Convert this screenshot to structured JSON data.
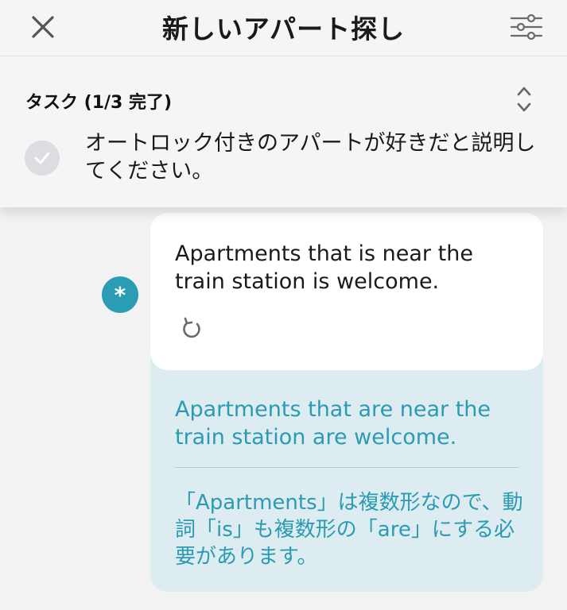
{
  "header": {
    "title": "新しいアパート探し",
    "close_icon": "close-icon",
    "filter_icon": "sliders-icon"
  },
  "task": {
    "label": "タスク (1/3 完了)",
    "description": "オートロック付きのアパートが好きだと説明してください。",
    "toggle_icon": "chevron-up-down-icon",
    "status_icon": "check-circle-icon"
  },
  "chat": {
    "avatar_symbol": "*",
    "original_message": "Apartments that is near the train station is welcome.",
    "retry_icon": "refresh-icon",
    "corrected_message": "Apartments that are near the train station are welcome.",
    "explanation": "「Apartments」は複数形なので、動詞「is」も複数形の「are」にする必要があります。"
  },
  "colors": {
    "accent": "#2a9db4",
    "correction_bg": "#dcecf0",
    "background": "#f2f2f2"
  }
}
